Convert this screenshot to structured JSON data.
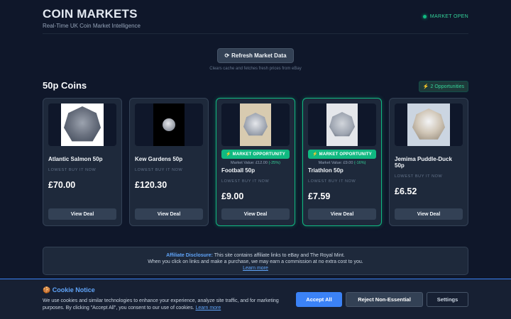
{
  "header": {
    "logo": "COIN MARKETS",
    "tagline": "Real-Time UK Coin Market Intelligence",
    "market_status": "MARKET OPEN"
  },
  "refresh": {
    "button_label": "Refresh Market Data",
    "hint": "Clears cache and fetches fresh prices from eBay"
  },
  "section": {
    "title": "50p Coins",
    "badge": "⚡ 2 Opportunities"
  },
  "cards": [
    {
      "name": "Atlantic Salmon 50p",
      "price_label": "LOWEST BUY IT NOW",
      "price": "£70.00",
      "button": "View Deal"
    },
    {
      "name": "Kew Gardens 50p",
      "price_label": "LOWEST BUY IT NOW",
      "price": "£120.30",
      "button": "View Deal"
    },
    {
      "name": "Football 50p",
      "opportunity": "⚡ MARKET OPPORTUNITY",
      "market_value": "Market Value: £12.00",
      "discount": "(-25%)",
      "price_label": "LOWEST BUY IT NOW",
      "price": "£9.00",
      "button": "View Deal"
    },
    {
      "name": "Triathlon 50p",
      "opportunity": "⚡ MARKET OPPORTUNITY",
      "market_value": "Market Value: £9.00",
      "discount": "(-16%)",
      "price_label": "LOWEST BUY IT NOW",
      "price": "£7.59",
      "button": "View Deal"
    },
    {
      "name": "Jemima Puddle-Duck 50p",
      "price_label": "LOWEST BUY IT NOW",
      "price": "£6.52",
      "button": "View Deal"
    }
  ],
  "disclosure": {
    "heading": "Affiliate Disclosure:",
    "line1": "This site contains affiliate links to eBay and The Royal Mint.",
    "line2": "When you click on links and make a purchase, we may earn a commission at no extra cost to you.",
    "link": "Learn more"
  },
  "cookie": {
    "title": "Cookie Notice",
    "text": "We use cookies and similar technologies to enhance your experience, analyze site traffic, and for marketing purposes. By clicking \"Accept All\", you consent to our use of cookies.",
    "link": "Learn more",
    "accept": "Accept All",
    "reject": "Reject Non-Essential",
    "settings": "Settings"
  }
}
